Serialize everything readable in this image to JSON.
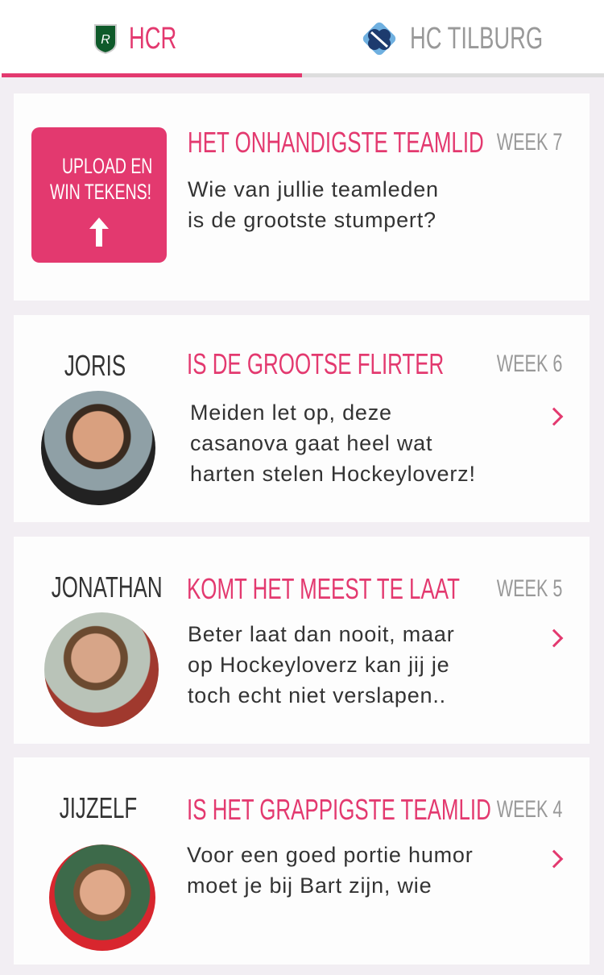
{
  "tabs": [
    {
      "label": "HCR",
      "active": true,
      "icon": "hcr-shield-logo"
    },
    {
      "label": "HC TILBURG",
      "active": false,
      "icon": "hc-tilburg-logo"
    }
  ],
  "colors": {
    "accent": "#e3396f",
    "inactive": "#999999",
    "background": "#f2eef3"
  },
  "challenge": {
    "upload_line1": "UPLOAD EN",
    "upload_line2": "WIN TEKENS!",
    "title": "HET ONHANDIGSTE TEAMLID",
    "week": "WEEK 7",
    "line1": "Wie van jullie teamleden",
    "line2": "is de grootste stumpert?"
  },
  "winners": [
    {
      "name": "JORIS",
      "title": "IS DE GROOTSE FLIRTER",
      "week": "WEEK 6",
      "lines": [
        "Meiden let op, deze",
        "casanova gaat heel wat",
        "harten stelen Hockeyloverz!"
      ]
    },
    {
      "name": "JONATHAN",
      "title": "KOMT HET MEEST TE LAAT",
      "week": "WEEK 5",
      "lines": [
        "Beter laat dan nooit, maar",
        "op Hockeyloverz kan jij je",
        "toch echt niet verslapen.."
      ]
    },
    {
      "name": "JIJZELF",
      "title": "IS HET GRAPPIGSTE TEAMLID",
      "week": "WEEK 4",
      "lines": [
        "Voor een goed portie humor",
        "moet je bij Bart zijn, wie"
      ]
    }
  ]
}
